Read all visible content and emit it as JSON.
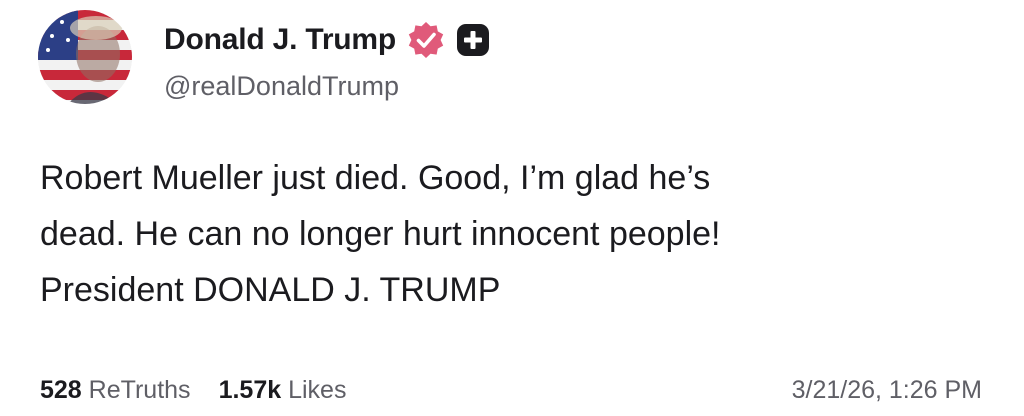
{
  "author": {
    "display_name": "Donald J. Trump",
    "handle": "@realDonaldTrump",
    "verified_icon": "verified-badge-icon",
    "extra_icon": "plus-icon",
    "avatar_icon": "flag-portrait-avatar"
  },
  "post": {
    "lines": [
      "Robert Mueller just died. Good, I’m glad he’s",
      "dead. He can no longer hurt innocent people!",
      "President DONALD J. TRUMP"
    ]
  },
  "stats": {
    "retruths_count": "528",
    "retruths_label": "ReTruths",
    "likes_count": "1.57k",
    "likes_label": "Likes"
  },
  "timestamp": "3/21/26, 1:26 PM",
  "colors": {
    "badge": "#e05a7a",
    "plus_bg": "#1b1b1f",
    "text": "#1b1b1f",
    "muted": "#5f5f66"
  }
}
